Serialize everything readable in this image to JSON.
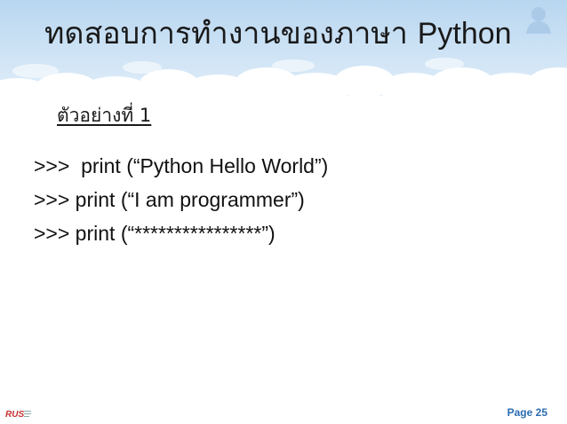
{
  "slide": {
    "title_thai": "ทดสอบการทำงานของภาษา",
    "title_latin": "Python",
    "subheading": "ตัวอย่างที่ 1",
    "code_lines": [
      ">>>  print (“Python Hello World”)",
      ">>> print (“I am programmer”)",
      ">>> print (“****************”)"
    ],
    "page_label": "Page 25",
    "logo_text": "RUS"
  },
  "colors": {
    "sky": "#cfe3f5",
    "cloud": "#ffffff",
    "page_number": "#2b6cb0",
    "logo": "#c53030"
  },
  "icons": [
    "cloud-banner",
    "user-silhouette-icon",
    "rus-logo"
  ]
}
